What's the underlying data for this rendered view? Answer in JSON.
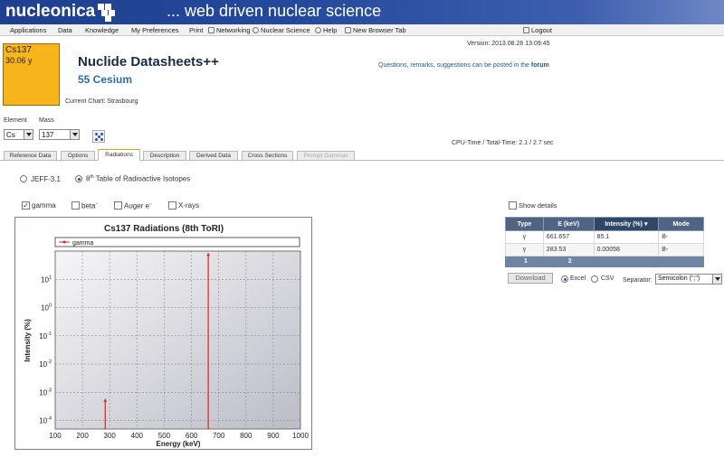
{
  "banner": {
    "logo": "nucleonica",
    "tagline": "... web driven nuclear science"
  },
  "menu": {
    "applications": "Applications",
    "data": "Data",
    "knowledge": "Knowledge",
    "my_preferences": "My Preferences",
    "print": "Print",
    "networking": "Networking",
    "nuclear_science": "Nuclear Science",
    "help": "Help",
    "new_browser_tab": "New Browser Tab",
    "logout": "Logout"
  },
  "nuclide": {
    "symbol": "Cs137",
    "half_life": "30.06 y",
    "color": "#f5b51b"
  },
  "header": {
    "title": "Nuclide Datasheets++",
    "subtitle": "55 Cesium",
    "current_chart": "Current Chart: Strasbourg",
    "version": "Version: 2013.08.26 13:09:45",
    "questions": "Questions, remarks, suggestions can be posted in the",
    "forum": "forum",
    "cpu_time": "CPU-Time / Total-Time: 2.1 / 2.7 sec"
  },
  "selectors": {
    "element_label": "Element",
    "mass_label": "Mass",
    "element_value": "Cs",
    "mass_value": "137"
  },
  "tabs": [
    {
      "label": "Reference Data"
    },
    {
      "label": "Options"
    },
    {
      "label": "Radiations"
    },
    {
      "label": "Description"
    },
    {
      "label": "Derived Data"
    },
    {
      "label": "Cross Sections"
    },
    {
      "label": "Prompt Gammas"
    }
  ],
  "source": {
    "jeff": "JEFF-3.1",
    "toi_prefix": "8",
    "toi_sup": "th",
    "toi_suffix": " Table of Radioactive Isotopes",
    "selected": "toi"
  },
  "radiation_types": {
    "gamma": "gamma",
    "beta": "beta",
    "beta_sup": "−",
    "auger": "Auger e",
    "auger_sup": "−",
    "xrays": "X-rays",
    "gamma_checked": true
  },
  "show_details": "Show details",
  "table": {
    "headers": [
      "Type",
      "E (keV)",
      "Intensity (%)",
      "Mode"
    ],
    "rows": [
      [
        "γ",
        "661.657",
        "85.1",
        "B-"
      ],
      [
        "γ",
        "283.53",
        "0.00058",
        "B-"
      ]
    ],
    "pages": [
      "1",
      "2"
    ]
  },
  "export": {
    "download": "Download",
    "excel": "Excel",
    "csv": "CSV",
    "separator_label": "Separator:",
    "separator_value": "Semicolon (\";\")"
  },
  "chart_data": {
    "type": "bar",
    "title": "Cs137 Radiations (8th ToRI)",
    "xlabel": "Energy (keV)",
    "ylabel": "Intensity (%)",
    "xlim": [
      100,
      1000
    ],
    "ylim": [
      5e-05,
      100
    ],
    "log_y": true,
    "grid": true,
    "legend_placement": "top",
    "x_ticks": [
      "100",
      "200",
      "300",
      "400",
      "500",
      "600",
      "700",
      "800",
      "900",
      "1000"
    ],
    "y_ticks": [
      {
        "base": "10",
        "exp": "1",
        "value": 10
      },
      {
        "base": "10",
        "exp": "0",
        "value": 1
      },
      {
        "base": "10",
        "exp": "-1",
        "value": 0.1
      },
      {
        "base": "10",
        "exp": "-2",
        "value": 0.01
      },
      {
        "base": "10",
        "exp": "-3",
        "value": 0.001
      },
      {
        "base": "10",
        "exp": "-4",
        "value": 0.0001
      }
    ],
    "series": [
      {
        "name": "gamma",
        "color": "#e02020",
        "points": [
          {
            "x": 283.53,
            "y": 0.00058
          },
          {
            "x": 661.657,
            "y": 85.1
          }
        ]
      }
    ]
  }
}
